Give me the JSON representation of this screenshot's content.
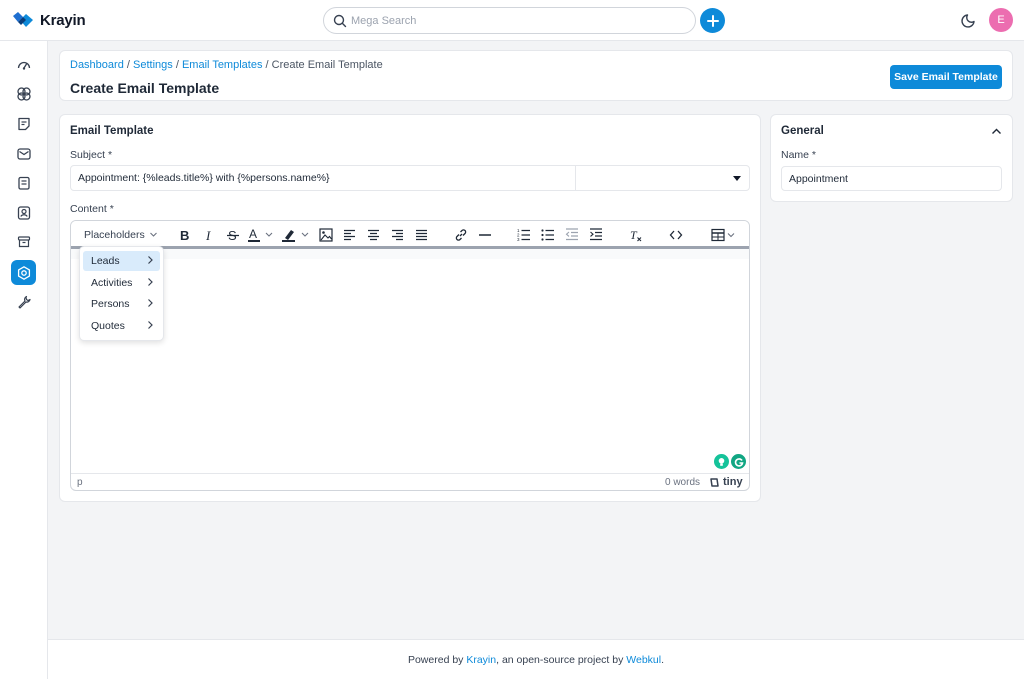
{
  "app": {
    "name": "Krayin"
  },
  "search": {
    "placeholder": "Mega Search"
  },
  "user": {
    "initial": "E"
  },
  "colors": {
    "accent": "#0e8ad9",
    "avatar": "#ec6db0"
  },
  "sidebar": {
    "items": [
      {
        "name": "dashboard",
        "icon": "gauge-icon"
      },
      {
        "name": "leads",
        "icon": "leads-icon"
      },
      {
        "name": "quotes",
        "icon": "quote-icon"
      },
      {
        "name": "mail",
        "icon": "mail-icon"
      },
      {
        "name": "activities",
        "icon": "clipboard-icon"
      },
      {
        "name": "contacts",
        "icon": "contact-icon"
      },
      {
        "name": "products",
        "icon": "box-icon"
      },
      {
        "name": "settings",
        "icon": "settings-icon",
        "active": true
      },
      {
        "name": "configuration",
        "icon": "wrench-icon"
      }
    ]
  },
  "breadcrumb": {
    "items": [
      "Dashboard",
      "Settings",
      "Email Templates"
    ],
    "current": "Create Email Template",
    "separator": "/"
  },
  "page": {
    "title": "Create Email Template",
    "save_label": "Save Email Template"
  },
  "form": {
    "section_title": "Email Template",
    "subject_label": "Subject *",
    "subject_value": "Appointment: {%leads.title%} with {%persons.name%}",
    "subject_select_value": "",
    "content_label": "Content *"
  },
  "editor": {
    "placeholders_label": "Placeholders",
    "status_path": "p",
    "word_count": "0 words",
    "brand": "tiny",
    "menu": [
      "Leads",
      "Activities",
      "Persons",
      "Quotes"
    ],
    "menu_active": "Leads"
  },
  "general": {
    "title": "General",
    "name_label": "Name *",
    "name_value": "Appointment"
  },
  "footer": {
    "prefix": "Powered by ",
    "link1": "Krayin",
    "middle": ", an open-source project by ",
    "link2": "Webkul",
    "suffix": "."
  }
}
